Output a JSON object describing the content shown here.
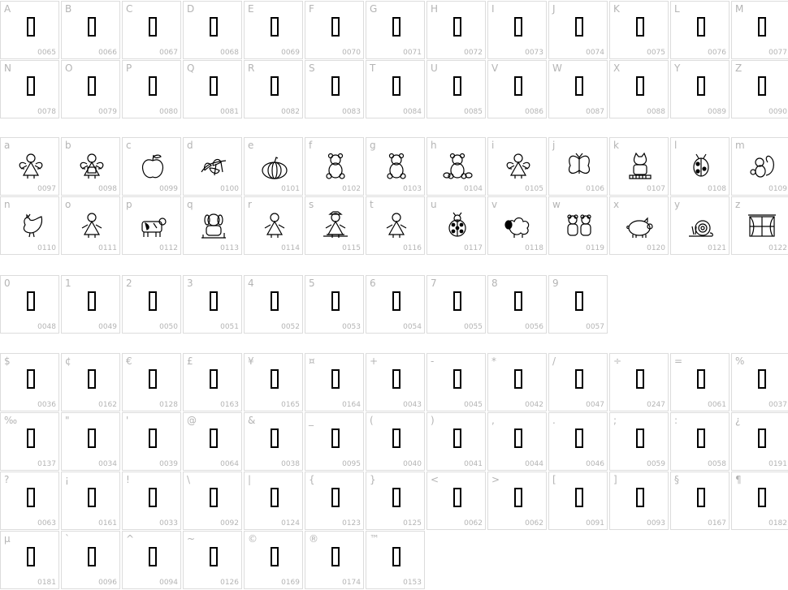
{
  "sections": [
    {
      "id": "uppercase",
      "cells": [
        {
          "label": "A",
          "code": "0065",
          "glyph": "box"
        },
        {
          "label": "B",
          "code": "0066",
          "glyph": "box"
        },
        {
          "label": "C",
          "code": "0067",
          "glyph": "box"
        },
        {
          "label": "D",
          "code": "0068",
          "glyph": "box"
        },
        {
          "label": "E",
          "code": "0069",
          "glyph": "box"
        },
        {
          "label": "F",
          "code": "0070",
          "glyph": "box"
        },
        {
          "label": "G",
          "code": "0071",
          "glyph": "box"
        },
        {
          "label": "H",
          "code": "0072",
          "glyph": "box"
        },
        {
          "label": "I",
          "code": "0073",
          "glyph": "box"
        },
        {
          "label": "J",
          "code": "0074",
          "glyph": "box"
        },
        {
          "label": "K",
          "code": "0075",
          "glyph": "box"
        },
        {
          "label": "L",
          "code": "0076",
          "glyph": "box"
        },
        {
          "label": "M",
          "code": "0077",
          "glyph": "box"
        },
        {
          "label": "N",
          "code": "0078",
          "glyph": "box"
        },
        {
          "label": "O",
          "code": "0079",
          "glyph": "box"
        },
        {
          "label": "P",
          "code": "0080",
          "glyph": "box"
        },
        {
          "label": "Q",
          "code": "0081",
          "glyph": "box"
        },
        {
          "label": "R",
          "code": "0082",
          "glyph": "box"
        },
        {
          "label": "S",
          "code": "0083",
          "glyph": "box"
        },
        {
          "label": "T",
          "code": "0084",
          "glyph": "box"
        },
        {
          "label": "U",
          "code": "0085",
          "glyph": "box"
        },
        {
          "label": "V",
          "code": "0086",
          "glyph": "box"
        },
        {
          "label": "W",
          "code": "0087",
          "glyph": "box"
        },
        {
          "label": "X",
          "code": "0088",
          "glyph": "box"
        },
        {
          "label": "Y",
          "code": "0089",
          "glyph": "box"
        },
        {
          "label": "Z",
          "code": "0090",
          "glyph": "box"
        }
      ]
    },
    {
      "id": "lowercase",
      "cells": [
        {
          "label": "a",
          "code": "0097",
          "glyph": "angel"
        },
        {
          "label": "b",
          "code": "0098",
          "glyph": "angel-basket"
        },
        {
          "label": "c",
          "code": "0099",
          "glyph": "apple"
        },
        {
          "label": "d",
          "code": "0100",
          "glyph": "leaves"
        },
        {
          "label": "e",
          "code": "0101",
          "glyph": "pumpkin"
        },
        {
          "label": "f",
          "code": "0102",
          "glyph": "teddy-bear"
        },
        {
          "label": "g",
          "code": "0103",
          "glyph": "teddy-bear-sitting"
        },
        {
          "label": "h",
          "code": "0104",
          "glyph": "bear-with-pumpkins"
        },
        {
          "label": "i",
          "code": "0105",
          "glyph": "angel-standing"
        },
        {
          "label": "j",
          "code": "0106",
          "glyph": "butterfly"
        },
        {
          "label": "k",
          "code": "0107",
          "glyph": "cat"
        },
        {
          "label": "l",
          "code": "0108",
          "glyph": "ladybug-bug"
        },
        {
          "label": "m",
          "code": "0109",
          "glyph": "squirrel"
        },
        {
          "label": "n",
          "code": "0110",
          "glyph": "rooster"
        },
        {
          "label": "o",
          "code": "0111",
          "glyph": "girl"
        },
        {
          "label": "p",
          "code": "0112",
          "glyph": "cow"
        },
        {
          "label": "q",
          "code": "0113",
          "glyph": "dog"
        },
        {
          "label": "r",
          "code": "0114",
          "glyph": "doll"
        },
        {
          "label": "s",
          "code": "0115",
          "glyph": "scarecrow"
        },
        {
          "label": "t",
          "code": "0116",
          "glyph": "rag-doll"
        },
        {
          "label": "u",
          "code": "0117",
          "glyph": "ladybug"
        },
        {
          "label": "v",
          "code": "0118",
          "glyph": "sheep"
        },
        {
          "label": "w",
          "code": "0119",
          "glyph": "two-bears"
        },
        {
          "label": "x",
          "code": "0120",
          "glyph": "pig"
        },
        {
          "label": "y",
          "code": "0121",
          "glyph": "snail"
        },
        {
          "label": "z",
          "code": "0122",
          "glyph": "window"
        }
      ]
    },
    {
      "id": "digits",
      "cells": [
        {
          "label": "0",
          "code": "0048",
          "glyph": "box"
        },
        {
          "label": "1",
          "code": "0049",
          "glyph": "box"
        },
        {
          "label": "2",
          "code": "0050",
          "glyph": "box"
        },
        {
          "label": "3",
          "code": "0051",
          "glyph": "box"
        },
        {
          "label": "4",
          "code": "0052",
          "glyph": "box"
        },
        {
          "label": "5",
          "code": "0053",
          "glyph": "box"
        },
        {
          "label": "6",
          "code": "0054",
          "glyph": "box"
        },
        {
          "label": "7",
          "code": "0055",
          "glyph": "box"
        },
        {
          "label": "8",
          "code": "0056",
          "glyph": "box"
        },
        {
          "label": "9",
          "code": "0057",
          "glyph": "box"
        }
      ]
    },
    {
      "id": "symbols",
      "cells": [
        {
          "label": "$",
          "code": "0036",
          "glyph": "box"
        },
        {
          "label": "¢",
          "code": "0162",
          "glyph": "box"
        },
        {
          "label": "€",
          "code": "0128",
          "glyph": "box"
        },
        {
          "label": "£",
          "code": "0163",
          "glyph": "box"
        },
        {
          "label": "¥",
          "code": "0165",
          "glyph": "box"
        },
        {
          "label": "¤",
          "code": "0164",
          "glyph": "box"
        },
        {
          "label": "+",
          "code": "0043",
          "glyph": "box"
        },
        {
          "label": "-",
          "code": "0045",
          "glyph": "box"
        },
        {
          "label": "*",
          "code": "0042",
          "glyph": "box"
        },
        {
          "label": "/",
          "code": "0047",
          "glyph": "box"
        },
        {
          "label": "÷",
          "code": "0247",
          "glyph": "box"
        },
        {
          "label": "=",
          "code": "0061",
          "glyph": "box"
        },
        {
          "label": "%",
          "code": "0037",
          "glyph": "box"
        },
        {
          "label": "‰",
          "code": "0137",
          "glyph": "box"
        },
        {
          "label": "\"",
          "code": "0034",
          "glyph": "box"
        },
        {
          "label": "'",
          "code": "0039",
          "glyph": "box"
        },
        {
          "label": "@",
          "code": "0064",
          "glyph": "box"
        },
        {
          "label": "&",
          "code": "0038",
          "glyph": "box"
        },
        {
          "label": "_",
          "code": "0095",
          "glyph": "box"
        },
        {
          "label": "(",
          "code": "0040",
          "glyph": "box"
        },
        {
          "label": ")",
          "code": "0041",
          "glyph": "box"
        },
        {
          "label": ",",
          "code": "0044",
          "glyph": "box"
        },
        {
          "label": ".",
          "code": "0046",
          "glyph": "box"
        },
        {
          "label": ";",
          "code": "0059",
          "glyph": "box"
        },
        {
          "label": ":",
          "code": "0058",
          "glyph": "box"
        },
        {
          "label": "¿",
          "code": "0191",
          "glyph": "box"
        },
        {
          "label": "?",
          "code": "0063",
          "glyph": "box"
        },
        {
          "label": "¡",
          "code": "0161",
          "glyph": "box"
        },
        {
          "label": "!",
          "code": "0033",
          "glyph": "box"
        },
        {
          "label": "\\",
          "code": "0092",
          "glyph": "box"
        },
        {
          "label": "|",
          "code": "0124",
          "glyph": "box"
        },
        {
          "label": "{",
          "code": "0123",
          "glyph": "box"
        },
        {
          "label": "}",
          "code": "0125",
          "glyph": "box"
        },
        {
          "label": "<",
          "code": "0062",
          "glyph": "box"
        },
        {
          "label": ">",
          "code": "0062",
          "glyph": "box"
        },
        {
          "label": "[",
          "code": "0091",
          "glyph": "box"
        },
        {
          "label": "]",
          "code": "0093",
          "glyph": "box"
        },
        {
          "label": "§",
          "code": "0167",
          "glyph": "box"
        },
        {
          "label": "¶",
          "code": "0182",
          "glyph": "box"
        },
        {
          "label": "µ",
          "code": "0181",
          "glyph": "box"
        },
        {
          "label": "`",
          "code": "0096",
          "glyph": "box"
        },
        {
          "label": "^",
          "code": "0094",
          "glyph": "box"
        },
        {
          "label": "~",
          "code": "0126",
          "glyph": "box"
        },
        {
          "label": "©",
          "code": "0169",
          "glyph": "box"
        },
        {
          "label": "®",
          "code": "0174",
          "glyph": "box"
        },
        {
          "label": "™",
          "code": "0153",
          "glyph": "box"
        }
      ]
    }
  ]
}
